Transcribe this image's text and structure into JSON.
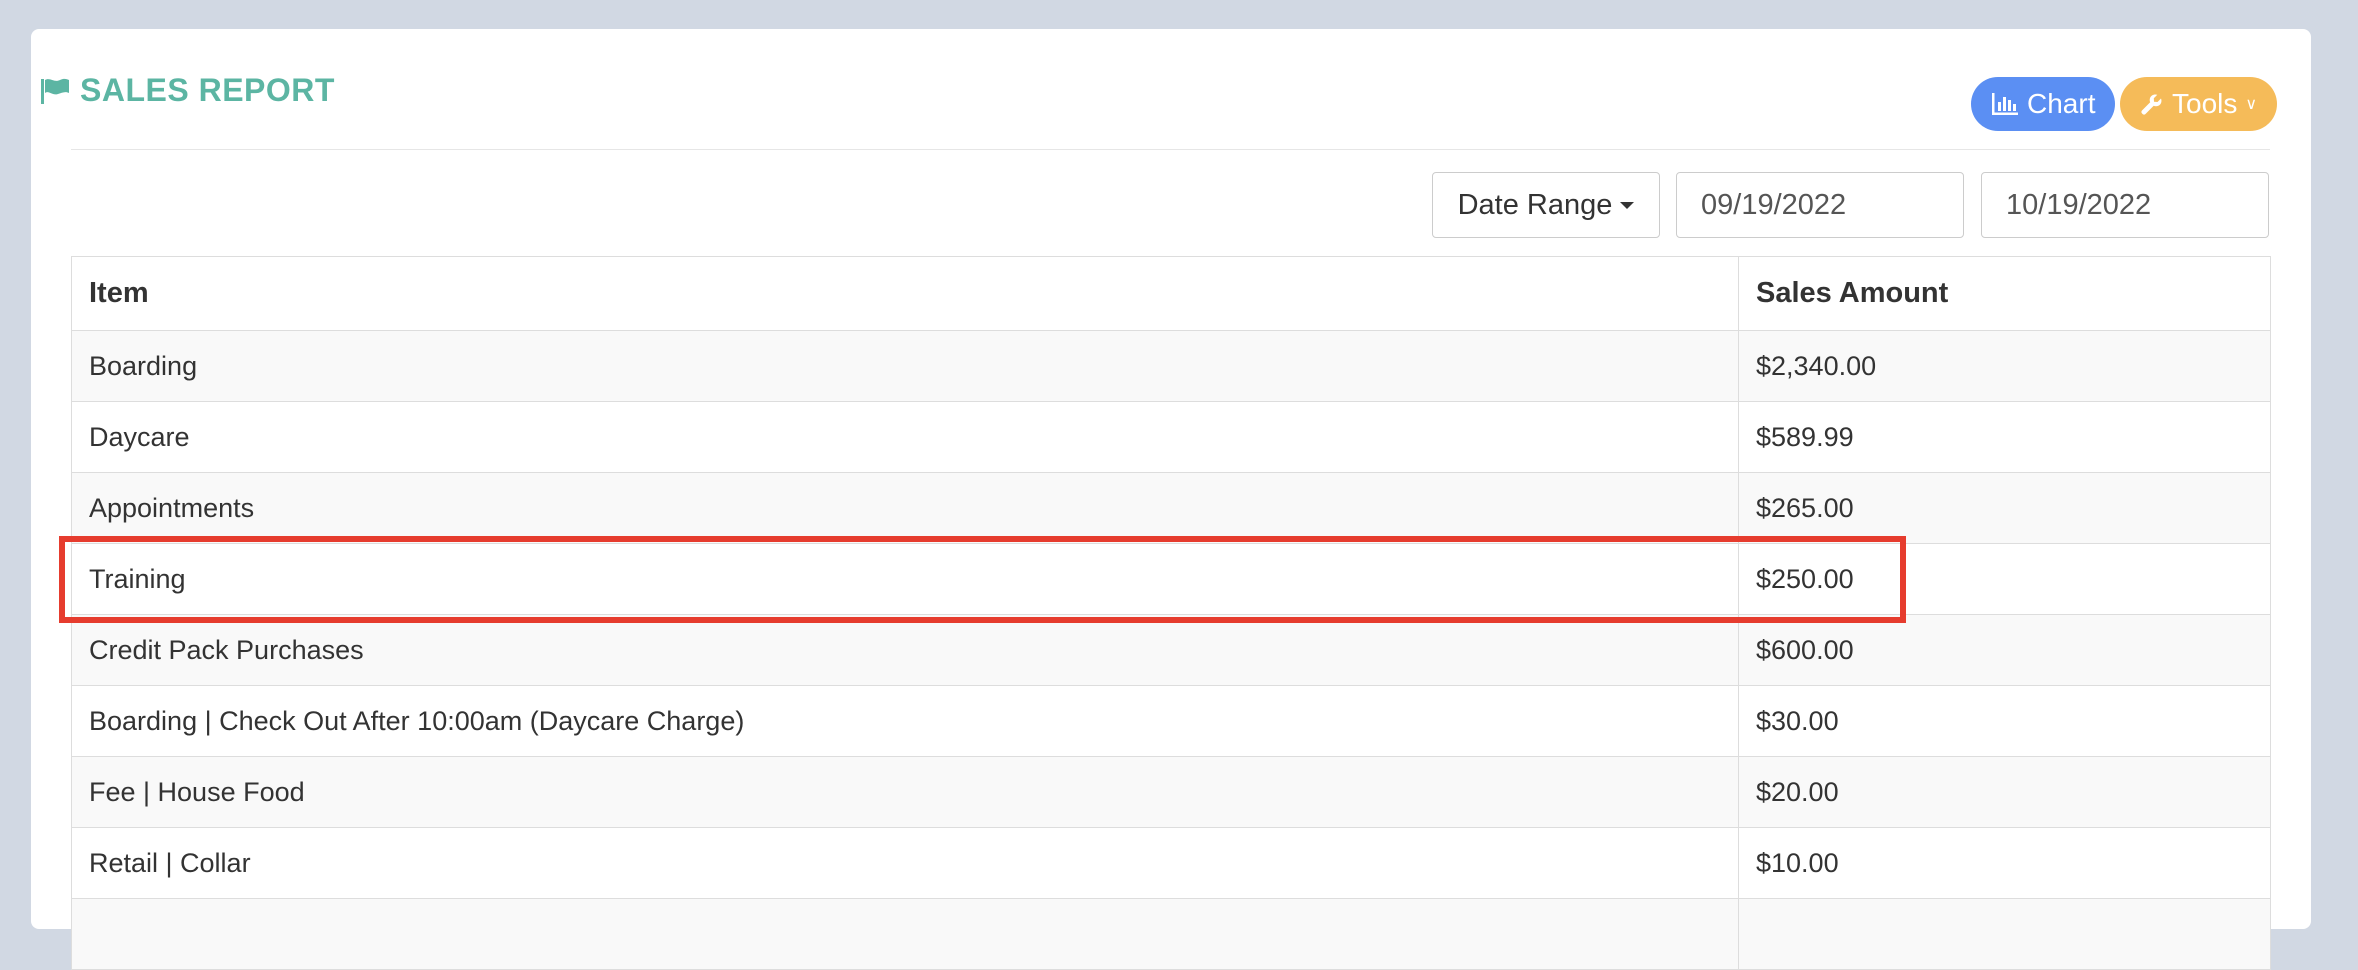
{
  "report": {
    "title": "SALES REPORT",
    "title_icon": "flag-icon",
    "accent_color": "#5cb5a3"
  },
  "toolbar": {
    "chart_label": "Chart",
    "chart_icon": "bar-chart-icon",
    "chart_color": "#5b8ff3",
    "tools_label": "Tools",
    "tools_icon": "wrench-icon",
    "tools_color": "#f5bb59"
  },
  "filters": {
    "date_range_label": "Date Range",
    "date_from": "09/19/2022",
    "date_to": "10/19/2022"
  },
  "table": {
    "headers": [
      "Item",
      "Sales Amount"
    ],
    "rows": [
      {
        "item": "Boarding",
        "amount": "$2,340.00"
      },
      {
        "item": "Daycare",
        "amount": "$589.99"
      },
      {
        "item": "Appointments",
        "amount": "$265.00"
      },
      {
        "item": "Training",
        "amount": "$250.00"
      },
      {
        "item": "Credit Pack Purchases",
        "amount": "$600.00"
      },
      {
        "item": "Boarding | Check Out After 10:00am (Daycare Charge)",
        "amount": "$30.00"
      },
      {
        "item": "Fee | House Food",
        "amount": "$20.00"
      },
      {
        "item": "Retail | Collar",
        "amount": "$10.00"
      },
      {
        "item": "",
        "amount": ""
      }
    ]
  },
  "annotation": {
    "highlight_color": "#e63c2e",
    "highlighted_row": "Training"
  }
}
